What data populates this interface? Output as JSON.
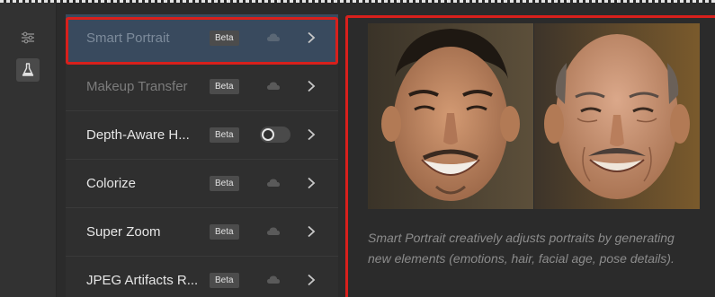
{
  "sidebar_rail": {
    "items": [
      {
        "icon": "sliders-icon",
        "active": false
      },
      {
        "icon": "flask-icon",
        "active": true
      }
    ]
  },
  "filters": [
    {
      "label": "Smart Portrait",
      "badge": "Beta",
      "state": "selected",
      "trailing": "cloud-download-icon"
    },
    {
      "label": "Makeup Transfer",
      "badge": "Beta",
      "state": "disabled",
      "trailing": "cloud-download-icon"
    },
    {
      "label": "Depth-Aware H...",
      "badge": "Beta",
      "state": "normal",
      "trailing": "toggle-off"
    },
    {
      "label": "Colorize",
      "badge": "Beta",
      "state": "normal",
      "trailing": "cloud-download-icon"
    },
    {
      "label": "Super Zoom",
      "badge": "Beta",
      "state": "normal",
      "trailing": "cloud-download-icon"
    },
    {
      "label": "JPEG Artifacts R...",
      "badge": "Beta",
      "state": "normal",
      "trailing": "cloud-download-icon"
    }
  ],
  "preview": {
    "description": "Smart Portrait creatively adjusts portraits by generating new elements (emotions, hair, facial age, pose details)."
  },
  "colors": {
    "highlight_border": "#d8201c",
    "selected_row": "#394a5e",
    "background": "#2b2b2b"
  }
}
